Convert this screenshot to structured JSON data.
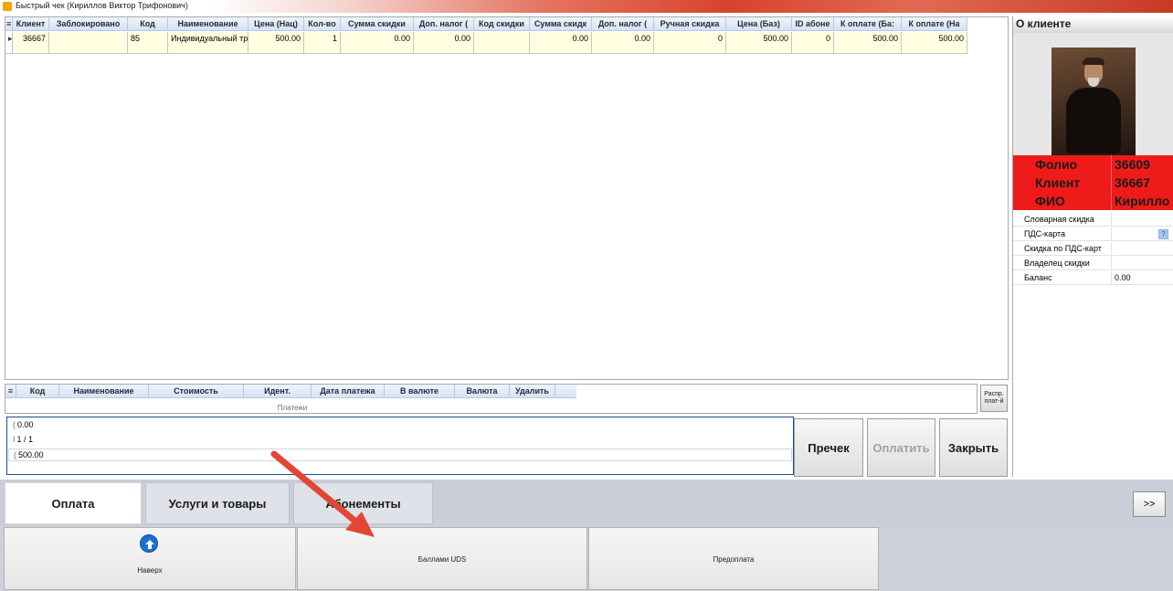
{
  "window": {
    "title": "Быстрый чек (Кириллов Виктор Трифонович)"
  },
  "items_grid": {
    "columns": [
      "Клиент",
      "Заблокировано",
      "Код",
      "Наименование",
      "Цена (Нац)",
      "Кол-во",
      "Сумма скидки",
      "Доп. налог (",
      "Код скидки",
      "Сумма скидк",
      "Доп. налог (",
      "Ручная скидка",
      "Цена (Баз)",
      "ID абоне",
      "К оплате (Ба:",
      "К оплате (На"
    ],
    "rows": [
      [
        "36667",
        "",
        "85",
        "Индивидуальный тр",
        "500.00",
        "1",
        "0.00",
        "0.00",
        "",
        "0.00",
        "0.00",
        "0",
        "500.00",
        "0",
        "500.00",
        "500.00"
      ]
    ]
  },
  "payments": {
    "columns": [
      "Код",
      "Наименование",
      "Стоимость",
      "Идент.",
      "Дата платежа",
      "В валюте",
      "Валюта",
      "Удалить"
    ],
    "caption": "Платежи",
    "distribute_button": "Распр. плат-й"
  },
  "summary": {
    "lines": [
      {
        "prefix": "(",
        "value": "0.00"
      },
      {
        "prefix": "I",
        "value": "1 / 1"
      },
      {
        "prefix": "(",
        "value": "500.00"
      }
    ]
  },
  "actions": {
    "precheck": "Пречек",
    "pay": "Оплатить",
    "close": "Закрыть"
  },
  "client_panel": {
    "header": "О клиенте",
    "highlight": [
      {
        "label": "Фолио",
        "value": "36609"
      },
      {
        "label": "Клиент",
        "value": "36667"
      },
      {
        "label": "ФИО",
        "value": "Кирилло"
      }
    ],
    "info": [
      {
        "label": "Словарная скидка",
        "value": ""
      },
      {
        "label": "ПДС-карта",
        "value": ""
      },
      {
        "label": "Скидка по ПДС-карт",
        "value": ""
      },
      {
        "label": "Владелец скидки",
        "value": ""
      },
      {
        "label": "Баланс",
        "value": "0.00"
      }
    ],
    "pds_help": "?"
  },
  "tabs": [
    "Оплата",
    "Услуги и товары",
    "Абонементы"
  ],
  "switch_button": ">>",
  "bottom_menu": {
    "up": "Наверх",
    "uds": "Баллами UDS",
    "prepay": "Предоплата"
  },
  "colors": {
    "highlight_red": "#ef1a1a",
    "grid_row": "#ffffe1",
    "header_blue": "#d6e3f3",
    "arrow": "#e04835"
  }
}
